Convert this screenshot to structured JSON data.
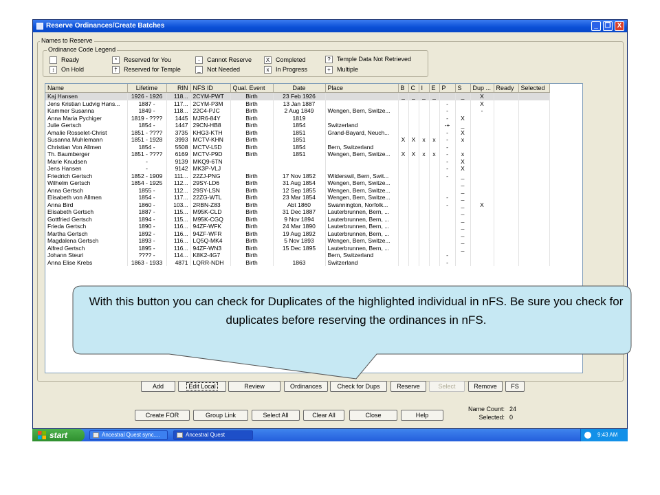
{
  "window": {
    "title": "Reserve Ordinances/Create Batches",
    "controls": [
      "_",
      "❐",
      "X"
    ]
  },
  "group_label": "Names to Reserve",
  "legend": {
    "title": "Ordinance Code Legend",
    "items": [
      {
        "symbol": "",
        "label": "Ready"
      },
      {
        "symbol": "↕",
        "label": "On Hold"
      },
      {
        "symbol": "*",
        "label": "Reserved for You"
      },
      {
        "symbol": "†",
        "label": "Reserved for Temple"
      },
      {
        "symbol": "-",
        "label": "Cannot Reserve"
      },
      {
        "symbol": "_",
        "label": "Not Needed"
      },
      {
        "symbol": "X",
        "label": "Completed"
      },
      {
        "symbol": "x",
        "label": "In Progress"
      },
      {
        "symbol": "?",
        "label": "Temple Data Not Retrieved"
      },
      {
        "symbol": "+",
        "label": "Multiple"
      }
    ]
  },
  "table": {
    "columns": [
      "Name",
      "Lifetime",
      "RIN",
      "NFS ID",
      "Qual. Event",
      "Date",
      "Place",
      "B",
      "C",
      "I",
      "E",
      "P",
      "S",
      "Dup ...",
      "Ready",
      "Selected"
    ],
    "rows": [
      [
        "Kaj Hansen",
        "1926 - 1926",
        "118...",
        "2CYM-PWT",
        "Birth",
        "23 Feb 1926",
        "",
        "_",
        "_",
        "_",
        "_",
        "",
        "_",
        "X",
        "",
        ""
      ],
      [
        "Jens Kristian Ludvig Hans...",
        "1887 -",
        "117...",
        "2CYM-P3M",
        "Birth",
        "13 Jan 1887",
        "",
        "",
        "",
        "",
        "",
        "-",
        "",
        "X",
        "",
        ""
      ],
      [
        "Kammer Susanna",
        "1849 -",
        "118...",
        "22C4-PJC",
        "Birth",
        "2 Aug 1849",
        "Wengen, Bern, Switze...",
        "",
        "",
        "",
        "",
        "-",
        "",
        "-",
        "",
        ""
      ],
      [
        "Anna Maria Pychiger",
        "1819 - ????",
        "1445",
        "MJR6-84Y",
        "Birth",
        "1819",
        "",
        "",
        "",
        "",
        "",
        "-",
        "X",
        "",
        "",
        ""
      ],
      [
        "Julie Gertsch",
        "1854 -",
        "1447",
        "29CN-HB8",
        "Birth",
        "1854",
        "Switzerland",
        "",
        "",
        "",
        "",
        "-+",
        "_",
        "",
        "",
        ""
      ],
      [
        "Amalie Rosselet-Christ",
        "1851 - ????",
        "3735",
        "KHG3-KTH",
        "Birth",
        "1851",
        "Grand-Bayard, Neuch...",
        "",
        "",
        "",
        "",
        "-",
        "X",
        "",
        "",
        ""
      ],
      [
        "Susanna Muhlemann",
        "1851 - 1928",
        "3993",
        "MCTV-KHN",
        "Birth",
        "1851",
        "",
        "X",
        "X",
        "x",
        "x",
        "-",
        "x",
        "",
        "",
        ""
      ],
      [
        "Christian Von Allmen",
        "1854 -",
        "5508",
        "MCTV-L5D",
        "Birth",
        "1854",
        "Bern, Switzerland",
        "",
        "",
        "",
        "",
        "-",
        "",
        "",
        "",
        ""
      ],
      [
        "Th. Baumberger",
        "1851 - ????",
        "6169",
        "MCTV-P9D",
        "Birth",
        "1851",
        "Wengen, Bern, Switze...",
        "X",
        "X",
        "x",
        "x",
        "-",
        "x",
        "",
        "",
        ""
      ],
      [
        "Marie Knudsen",
        "-",
        "9139",
        "MKQ9-6TN",
        "",
        "",
        "",
        "",
        "",
        "",
        "",
        "-",
        "X",
        "",
        "",
        ""
      ],
      [
        "Jens Hansen",
        "-",
        "9142",
        "MK3P-VLJ",
        "",
        "",
        "",
        "",
        "",
        "",
        "",
        "-",
        "X",
        "",
        "",
        ""
      ],
      [
        "Friedrich Gertsch",
        "1852 - 1909",
        "111...",
        "22ZJ-PNG",
        "Birth",
        "17 Nov 1852",
        "Wilderswil, Bern, Swit...",
        "",
        "",
        "",
        "",
        "-",
        "_",
        "",
        "",
        ""
      ],
      [
        "Wilhelm Gertsch",
        "1854 - 1925",
        "112...",
        "29SY-LD6",
        "Birth",
        "31 Aug 1854",
        "Wengen, Bern, Switze...",
        "",
        "",
        "",
        "",
        "",
        "_",
        "",
        "",
        ""
      ],
      [
        "Anna Gertsch",
        "1855 -",
        "112...",
        "29SY-LSN",
        "Birth",
        "12 Sep 1855",
        "Wengen, Bern, Switze...",
        "",
        "",
        "",
        "",
        "",
        "_",
        "",
        "",
        ""
      ],
      [
        "Elisabeth von Allmen",
        "1854 -",
        "117...",
        "22ZG-WTL",
        "Birth",
        "23 Mar 1854",
        "Wengen, Bern, Switze...",
        "",
        "",
        "",
        "",
        "-",
        "_",
        "",
        "",
        ""
      ],
      [
        "Anna Bird",
        "1860 -",
        "103...",
        "2RBN-Z83",
        "Birth",
        "Abt 1860",
        "Swannington, Norfolk...",
        "",
        "",
        "",
        "",
        "-",
        "_",
        "X",
        "",
        ""
      ],
      [
        "Elisabeth Gertsch",
        "1887 -",
        "115...",
        "M95K-CLD",
        "Birth",
        "31 Dec 1887",
        "Lauterbrunnen, Bern, ...",
        "",
        "",
        "",
        "",
        "",
        "_",
        "",
        "",
        ""
      ],
      [
        "Gottfried Gertsch",
        "1894 -",
        "115...",
        "M95K-CGQ",
        "Birth",
        "9 Nov 1894",
        "Lauterbrunnen, Bern, ...",
        "",
        "",
        "",
        "",
        "",
        "_",
        "",
        "",
        ""
      ],
      [
        "Frieda Gertsch",
        "1890 -",
        "116...",
        "94ZF-WFK",
        "Birth",
        "24 Mar 1890",
        "Lauterbrunnen, Bern, ...",
        "",
        "",
        "",
        "",
        "",
        "_",
        "",
        "",
        ""
      ],
      [
        "Martha Gertsch",
        "1892 -",
        "116...",
        "94ZF-WFR",
        "Birth",
        "19 Aug 1892",
        "Lauterbrunnen, Bern, ...",
        "",
        "",
        "",
        "",
        "",
        "_",
        "",
        "",
        ""
      ],
      [
        "Magdalena Gertsch",
        "1893 -",
        "116...",
        "LQ5Q-MK4",
        "Birth",
        "5 Nov 1893",
        "Wengen, Bern, Switze...",
        "",
        "",
        "",
        "",
        "",
        "_",
        "",
        "",
        ""
      ],
      [
        "Alfred Gertsch",
        "1895 -",
        "116...",
        "94ZF-WN3",
        "Birth",
        "15 Dec 1895",
        "Lauterbrunnen, Bern, ...",
        "",
        "",
        "",
        "",
        "",
        "_",
        "",
        "",
        ""
      ],
      [
        "Johann Steuri",
        "???? -",
        "114...",
        "K8K2-4G7",
        "Birth",
        "",
        "Bern, Switzerland",
        "",
        "",
        "",
        "",
        "-",
        "",
        "",
        "",
        ""
      ],
      [
        "Anna Elise Krebs",
        "1863 - 1933",
        "4871",
        "LQRR-NDH",
        "Birth",
        "1863",
        "Switzerland",
        "",
        "",
        "",
        "",
        "-",
        "",
        "",
        "",
        ""
      ]
    ]
  },
  "row_buttons": [
    "Add",
    "Edit Local",
    "Review",
    "Ordinances",
    "Check for Dups",
    "Reserve",
    "Select",
    "Remove",
    "FS"
  ],
  "bottom_buttons": [
    "Create FOR",
    "Group Link",
    "Select All",
    "Clear All",
    "Close",
    "Help"
  ],
  "status": {
    "name_count_label": "Name Count:",
    "name_count": "24",
    "selected_label": "Selected:",
    "selected": "0"
  },
  "taskbar": {
    "start": "start",
    "tasks": [
      "Ancestral Quest sync....",
      "Ancestral Quest"
    ],
    "clock": "9:43 AM"
  },
  "callout": {
    "text": "With this button you can check for Duplicates of the highlighted individual in nFS.  Be sure you check for duplicates before reserving the ordinances in nFS."
  },
  "colors": {
    "title_bar": "#0a4fd6",
    "window_bg": "#ece9d8",
    "callout_fill": "#c6e8f3",
    "taskbar": "#245edb",
    "start": "#3a9c3a"
  }
}
